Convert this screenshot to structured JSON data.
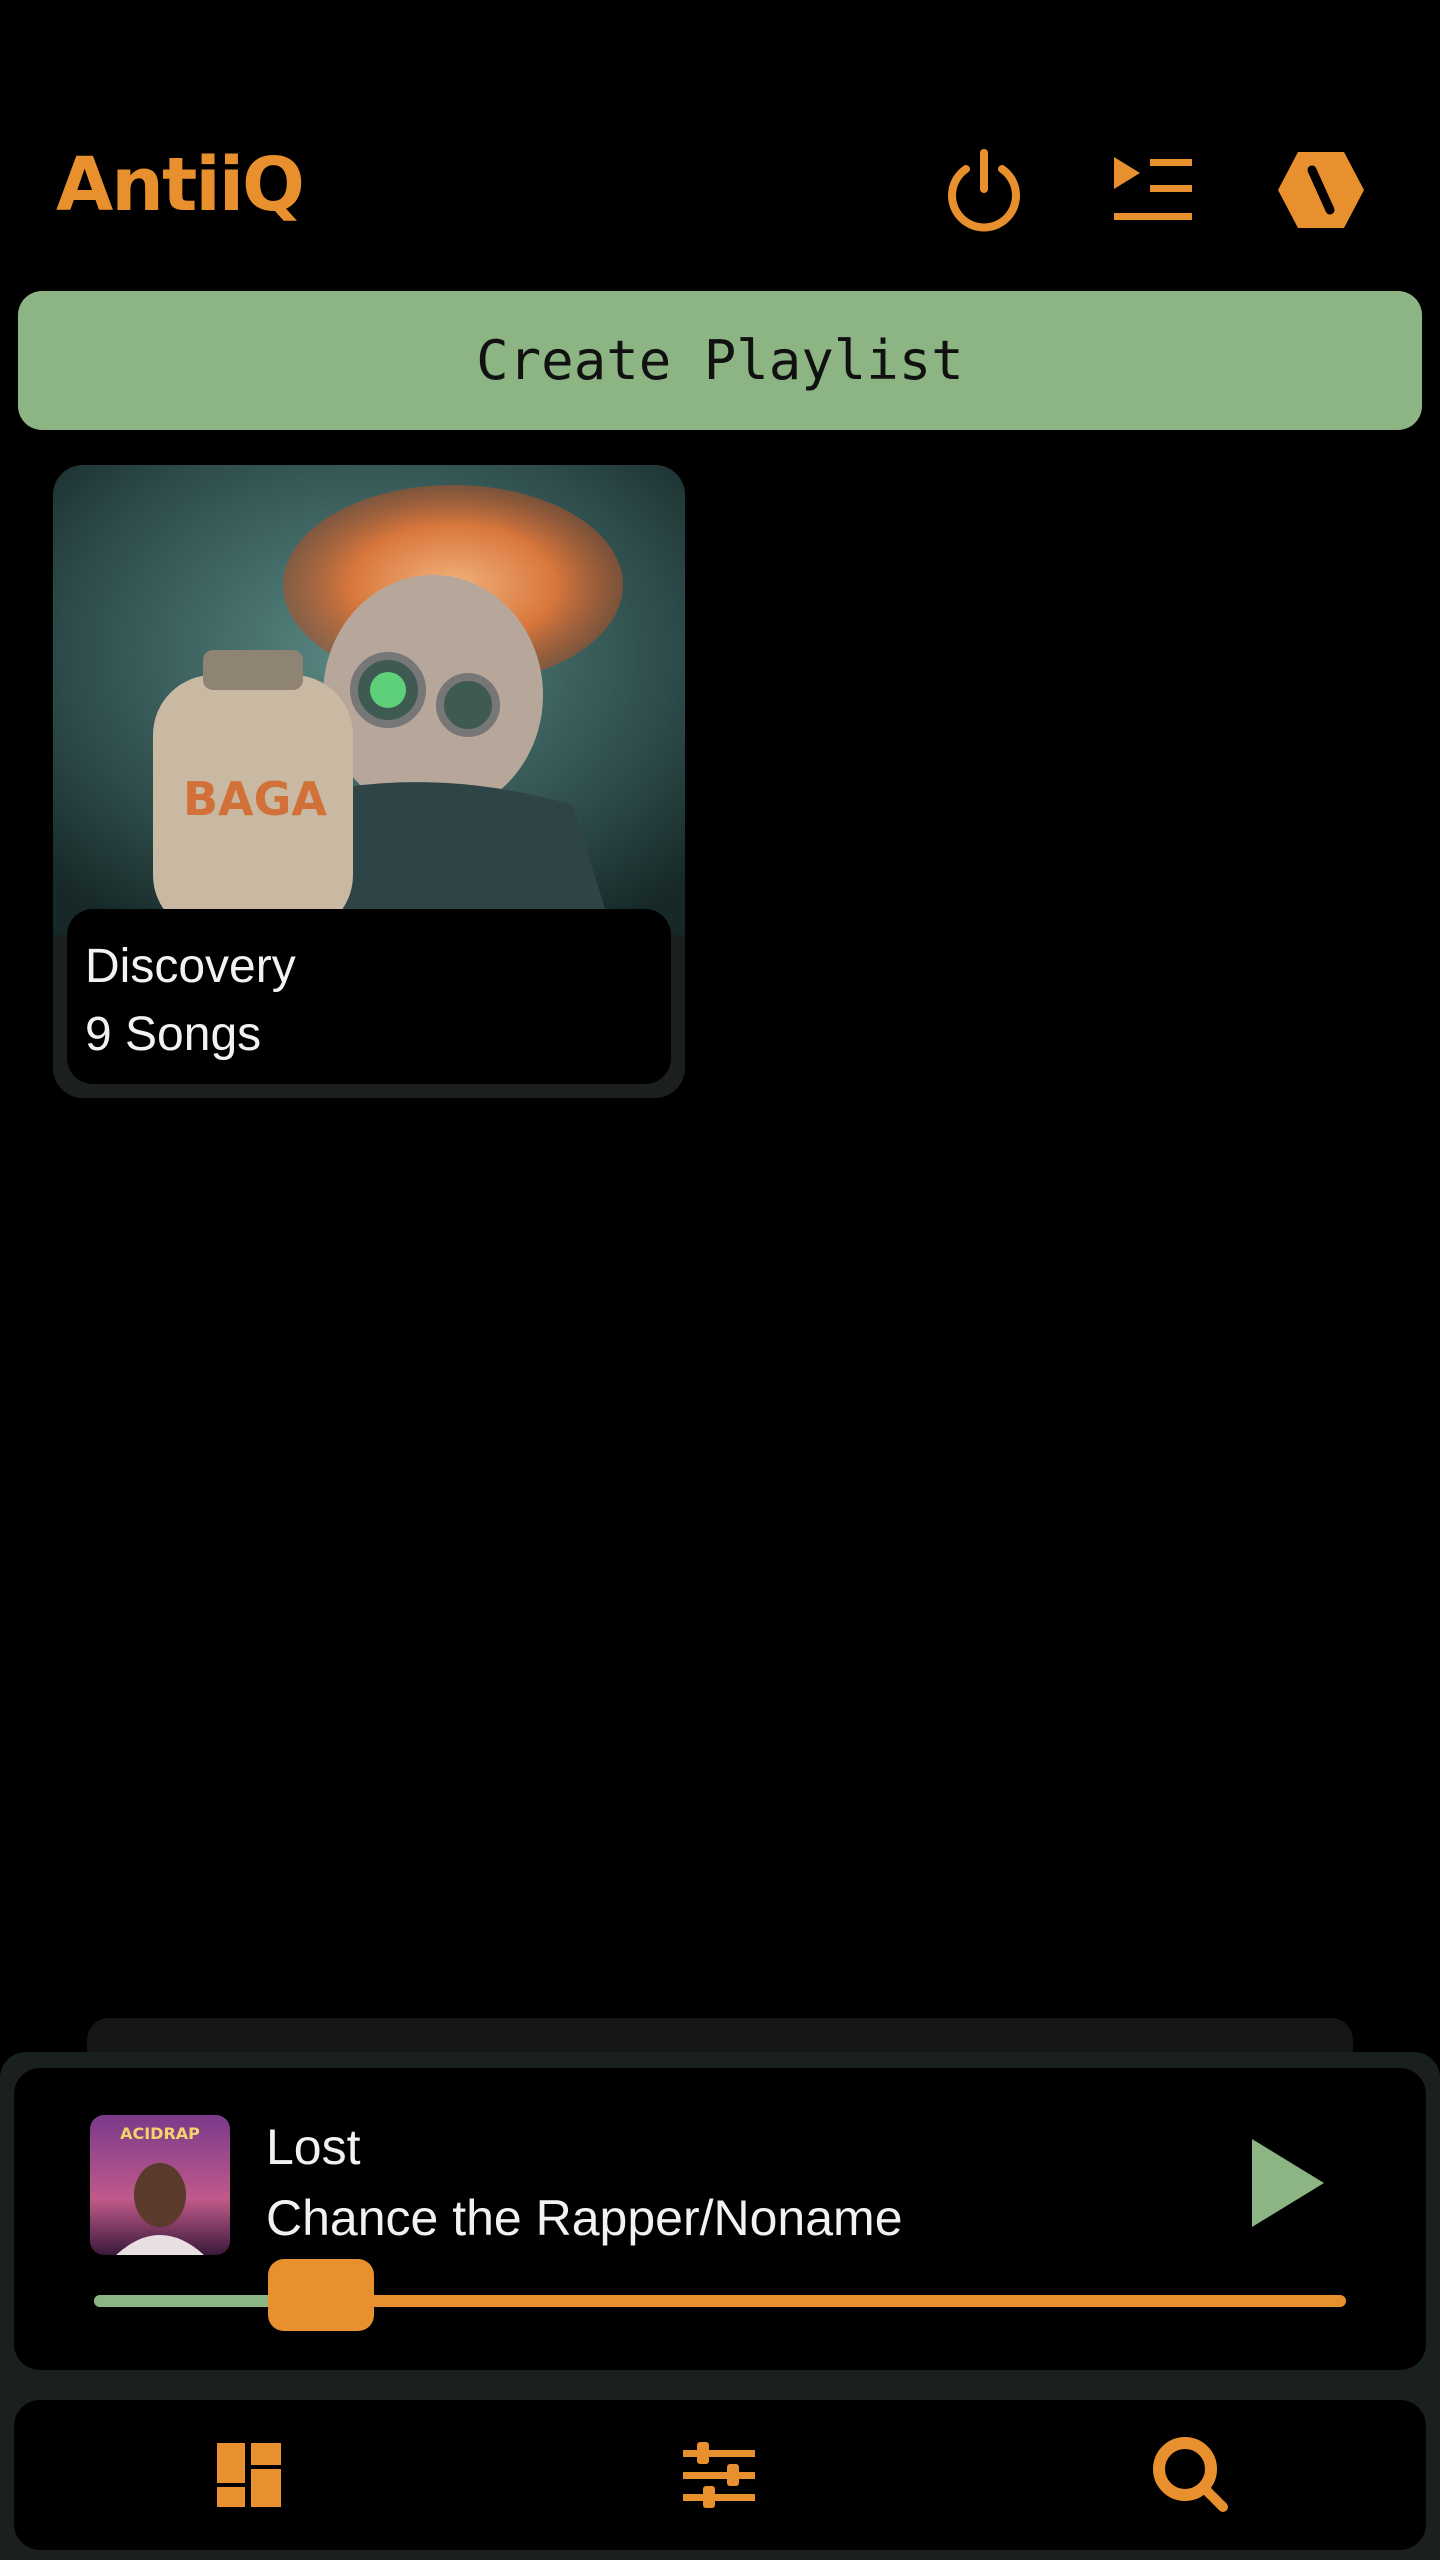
{
  "app": {
    "title": "AntiiQ",
    "accent_color": "#E8902E",
    "secondary_color": "#8DB584"
  },
  "header": {
    "icons": [
      "power-icon",
      "queue-icon",
      "theme-hexagon-icon"
    ]
  },
  "create_playlist": {
    "label": "Create Playlist"
  },
  "playlists": [
    {
      "name": "Discovery",
      "count": "9 Songs"
    }
  ],
  "now_playing": {
    "title": "Lost",
    "artist": "Chance the Rapper/Noname",
    "progress": 0.13,
    "play_icon": "play-icon"
  },
  "bottom_nav": {
    "items": [
      "dashboard-icon",
      "equalizer-icon",
      "search-icon"
    ]
  }
}
